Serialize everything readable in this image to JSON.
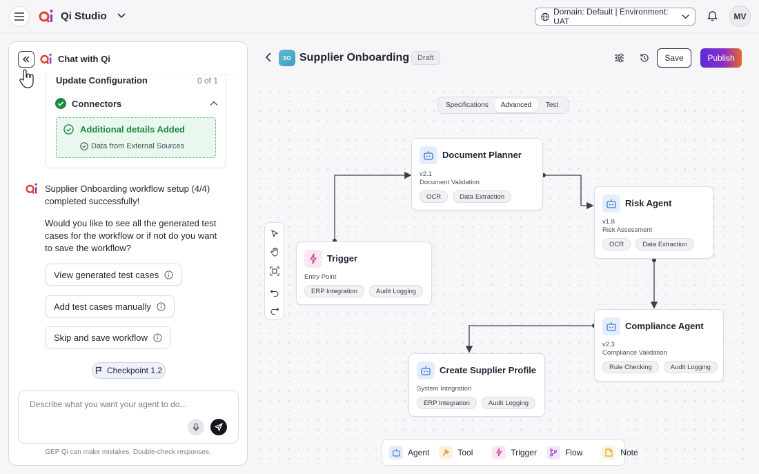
{
  "header": {
    "app_name": "Qi Studio",
    "domain_selector": "Domain: Default | Environment: UAT",
    "avatar_initials": "MV"
  },
  "chat": {
    "title": "Chat with Qi",
    "config": {
      "title": "Update Configuration",
      "count": "0 of 1",
      "connectors_label": "Connectors",
      "added_title": "Additional details Added",
      "added_item": "Data from External Sources"
    },
    "message_1": "Supplier Onboarding workflow setup (4/4) completed successfully!",
    "message_2": "Would you like to see all the generated test cases for the workflow or if not do you want to save the workflow?",
    "options": [
      {
        "label": "View generated test cases"
      },
      {
        "label": "Add test cases manually"
      },
      {
        "label": "Skip and save workflow"
      }
    ],
    "checkpoint": "Checkpoint 1.2",
    "input_placeholder": "Describe what you want your agent to do...",
    "disclaimer": "GEP Qi can make mistakes. Double-check responses."
  },
  "workflow": {
    "badge": "SO",
    "title": "Supplier Onboarding",
    "status": "Draft",
    "save_label": "Save",
    "publish_label": "Publish",
    "tabs": [
      "Specifications",
      "Advanced",
      "Test"
    ],
    "active_tab": "Advanced"
  },
  "nodes": {
    "planner": {
      "title": "Document Planner",
      "version": "v2.1",
      "desc": "Document Validation",
      "tags": [
        "OCR",
        "Data Extraction"
      ]
    },
    "risk": {
      "title": "Risk Agent",
      "version": "v1.8",
      "desc": "Risk Assessment",
      "tags": [
        "OCR",
        "Data Extraction"
      ]
    },
    "trigger": {
      "title": "Trigger",
      "desc": "Entry Point",
      "tags": [
        "ERP Integration",
        "Audit Logging"
      ]
    },
    "compliance": {
      "title": "Compliance Agent",
      "version": "v2.3",
      "desc": "Compliance Validation",
      "tags": [
        "Rule Checking",
        "Audit Logging"
      ]
    },
    "supplier": {
      "title": "Create Supplier Profile",
      "desc": "System Integration",
      "tags": [
        "ERP Integration",
        "Audit Logging"
      ]
    }
  },
  "legend": [
    {
      "label": "Agent",
      "icon": "robot-icon",
      "color": "#e3edfb"
    },
    {
      "label": "Tool",
      "icon": "hammer-icon",
      "color": "#fdf0dc"
    },
    {
      "label": "Trigger",
      "icon": "lightning-icon",
      "color": "#fbe6f3"
    },
    {
      "label": "Flow",
      "icon": "branch-icon",
      "color": "#f3e6fb"
    },
    {
      "label": "Note",
      "icon": "note-icon",
      "color": "#fdf4dc"
    }
  ],
  "colors": {
    "accent_purple": "#5b2bd9",
    "accent_orange": "#e66a2a",
    "success_green": "#1d8a44",
    "agent_blue": "#3b78c9",
    "trigger_pink": "#d13a8c"
  }
}
